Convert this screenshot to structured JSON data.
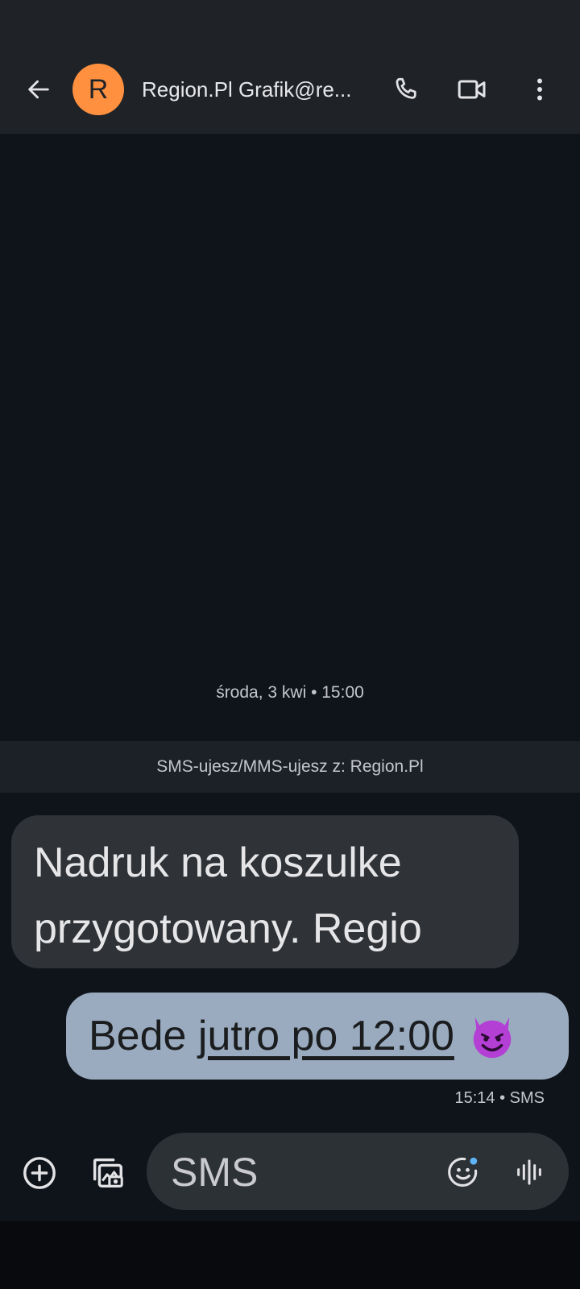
{
  "header": {
    "avatar_letter": "R",
    "contact_name": "Region.Pl Grafik@re...",
    "icons": [
      "arrow-left-icon",
      "phone-icon",
      "video-icon",
      "more-vert-icon"
    ]
  },
  "conversation": {
    "date_separator": "środa, 3 kwi • 15:00",
    "sms_banner": "SMS-ujesz/MMS-ujesz z: Region.Pl",
    "incoming": {
      "line1": "Nadruk na koszulke",
      "line2": "przygotowany. Regio"
    },
    "outgoing": {
      "prefix": "Bede ",
      "link": "jutro po 12:00",
      "emoji": "😈"
    },
    "outgoing_meta": "15:14 • SMS"
  },
  "composer": {
    "placeholder": "SMS",
    "icons": [
      "add-circle-icon",
      "gallery-icon",
      "emoji-icon",
      "voice-icon"
    ]
  },
  "colors": {
    "background": "#0f141b",
    "app_bar": "#1f2328",
    "avatar": "#ff9040",
    "incoming_bubble": "#2f3337",
    "outgoing_bubble": "#9aabbf",
    "emoji_purple": "#b43fd4"
  }
}
